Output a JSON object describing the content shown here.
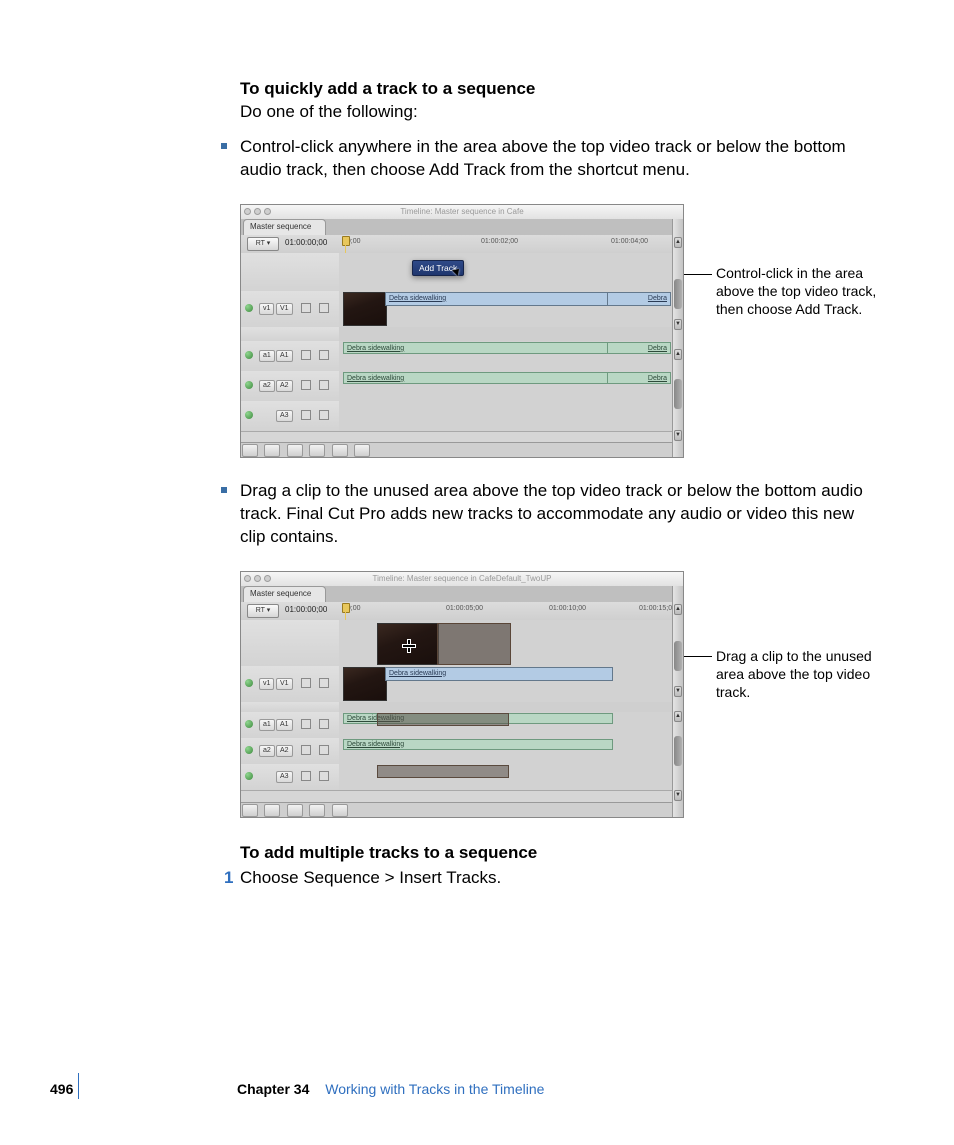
{
  "headings": {
    "quick_add": "To quickly add a track to a sequence",
    "quick_add_sub": "Do one of the following:",
    "add_multi": "To add multiple tracks to a sequence"
  },
  "bullets": {
    "b1": "Control-click anywhere in the area above the top video track or below the bottom audio track, then choose Add Track from the shortcut menu.",
    "b2": "Drag a clip to the unused area above the top video track or below the bottom audio track. Final Cut Pro adds new tracks to accommodate any audio or video this new clip contains."
  },
  "steps": {
    "s1_num": "1",
    "s1_text": "Choose Sequence > Insert Tracks."
  },
  "callouts": {
    "c1": "Control-click in the area above the top video track, then choose Add Track.",
    "c2": "Drag a clip to the unused area above the top video track."
  },
  "fig1": {
    "win_title": "Timeline: Master sequence in Cafe",
    "tab": "Master sequence",
    "rt": "RT ▾",
    "tc_main": "01:00:00;00",
    "ruler": {
      "r0": "00;00",
      "r1": "01:00:02;00",
      "r2": "01:00:04;00"
    },
    "menu": "Add Track",
    "track_v1_a": "v1",
    "track_v1_b": "V1",
    "track_a1_a": "a1",
    "track_a1_b": "A1",
    "track_a2_a": "a2",
    "track_a2_b": "A2",
    "track_a3_b": "A3",
    "clip_name": "Debra sidewalking"
  },
  "fig2": {
    "win_title": "Timeline: Master sequence in CafeDefault_TwoUP",
    "tab": "Master sequence",
    "rt": "RT ▾",
    "tc_main": "01:00:00;00",
    "ruler": {
      "r0": "00;00",
      "r1": "01:00:05;00",
      "r2": "01:00:10;00",
      "r3": "01:00:15;00"
    },
    "track_v1_a": "v1",
    "track_v1_b": "V1",
    "track_a1_a": "a1",
    "track_a1_b": "A1",
    "track_a2_a": "a2",
    "track_a2_b": "A2",
    "track_a3_b": "A3",
    "clip_name": "Debra sidewalking"
  },
  "footer": {
    "page": "496",
    "chapter_label": "Chapter 34",
    "chapter_title": "Working with Tracks in the Timeline"
  }
}
